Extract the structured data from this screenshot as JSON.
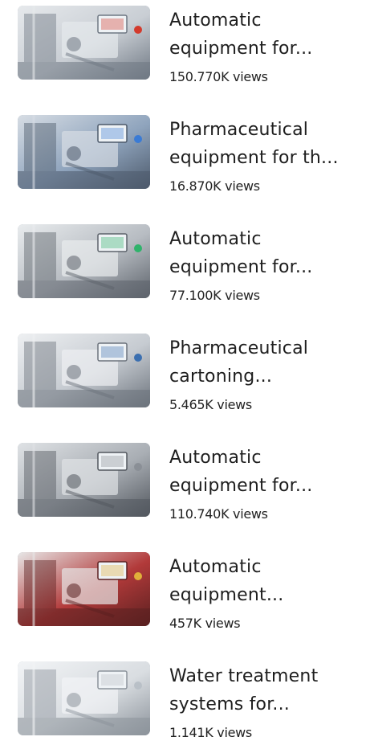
{
  "videos": [
    {
      "title": "Automatic equipment for...",
      "views": "150.770K views",
      "thumb_icon": "machine-thumbnail-icon",
      "palette": [
        "#c9ced4",
        "#6f7883",
        "#e6e9ec"
      ],
      "accent": "#d33a2c"
    },
    {
      "title": "Pharmaceutical equipment for th...",
      "views": "16.870K views",
      "thumb_icon": "machine-thumbnail-icon",
      "palette": [
        "#8fa4bd",
        "#4d5a6b",
        "#d7dde4"
      ],
      "accent": "#3a7bd5"
    },
    {
      "title": "Automatic equipment for...",
      "views": "77.100K views",
      "thumb_icon": "machine-thumbnail-icon",
      "palette": [
        "#b7bcc2",
        "#5d636b",
        "#e9ecee"
      ],
      "accent": "#2fb36b"
    },
    {
      "title": "Pharmaceutical cartoning...",
      "views": "5.465K views",
      "thumb_icon": "machine-thumbnail-icon",
      "palette": [
        "#c6cbd1",
        "#6c737c",
        "#eef0f2"
      ],
      "accent": "#3b6fb0"
    },
    {
      "title": "Automatic equipment for...",
      "views": "110.740K views",
      "thumb_icon": "machine-thumbnail-icon",
      "palette": [
        "#a9aeb4",
        "#52575e",
        "#dfe2e5"
      ],
      "accent": "#8a8f96"
    },
    {
      "title": "Automatic equipment...",
      "views": "457K views",
      "thumb_icon": "machine-thumbnail-icon",
      "palette": [
        "#b23a3a",
        "#5a2020",
        "#e7e7e7"
      ],
      "accent": "#e0b03a"
    },
    {
      "title": "Water treatment systems for...",
      "views": "1.141K views",
      "thumb_icon": "machine-thumbnail-icon",
      "palette": [
        "#d9dde1",
        "#8c939b",
        "#f2f4f6"
      ],
      "accent": "#b9c0c7"
    }
  ]
}
